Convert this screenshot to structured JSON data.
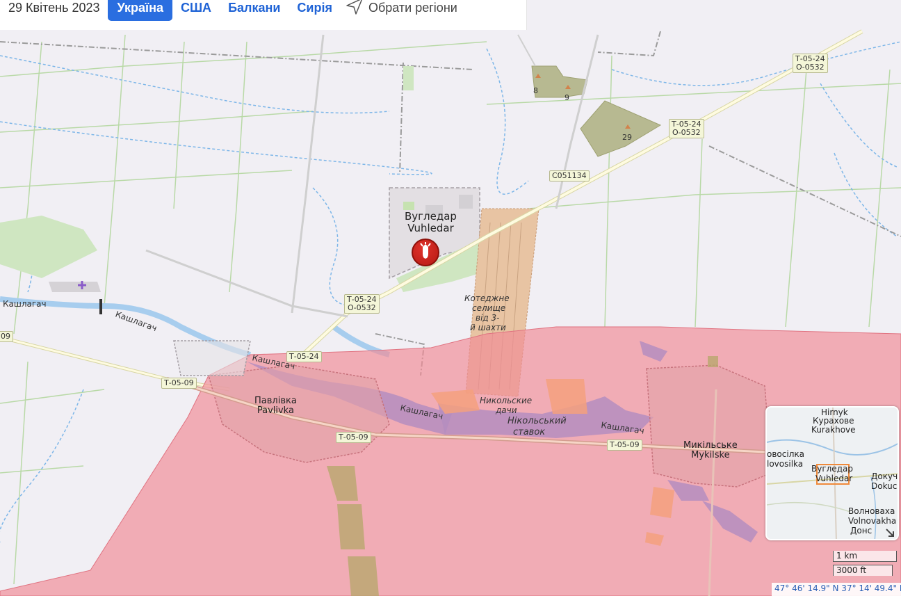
{
  "header": {
    "date": "29 Квітень 2023",
    "tabs": [
      {
        "label": "Україна",
        "active": true
      },
      {
        "label": "США",
        "active": false
      },
      {
        "label": "Балкани",
        "active": false
      },
      {
        "label": "Сирія",
        "active": false
      }
    ],
    "regions_label": "Обрати регіони",
    "regions_icon": "navigation-arrow-icon"
  },
  "map": {
    "occupied_zone_color": "#f08c96",
    "towns": {
      "vuhledar": {
        "uk": "Вугледар",
        "en": "Vuhledar"
      },
      "pavlivka": {
        "uk": "Павлівка",
        "en": "Pavlivka"
      },
      "mykilske": {
        "uk": "Микільське",
        "en": "Mykilske"
      }
    },
    "settlement_note": [
      "Котеджне",
      "селище",
      "від 3-",
      "й шахти"
    ],
    "nykolski_dachi": [
      "Никольские",
      "дачи"
    ],
    "reservoir": [
      "Нікольський",
      "ставок"
    ],
    "rivers": [
      "Кашлагач",
      "Кашлагач",
      "Кашлагач",
      "Кашлагач"
    ],
    "peaks": [
      "8",
      "9",
      "29"
    ],
    "road_labels": {
      "t0524_o0532_a": [
        "Т-05-24",
        "О-0532"
      ],
      "t0524_o0532_b": [
        "Т-05-24",
        "О-0532"
      ],
      "t0524_o0532_c": [
        "Т-05-24",
        "О-0532"
      ],
      "c051134": "С051134",
      "t0524": "Т-05-24",
      "t0509_a": "Т-05-09",
      "t0509_b": "Т-05-09",
      "t0509_c": "Т-05-09",
      "left_cut": "09"
    },
    "marker_icon": "explosion-bomb-icon"
  },
  "inset": {
    "labels": {
      "hirnyk": "Hirnyk",
      "kurakhove_uk": "Курахове",
      "kurakhove_en": "Kurakhove",
      "novosilka_uk": "овосілка",
      "novosilka_en": "lovosilka",
      "vuhledar_uk": "Вугледар",
      "vuhledar_en": "Vuhledar",
      "dokuch_uk": "Докуч",
      "dokuch_en": "Dokuc",
      "volnovakha_uk": "Волноваха",
      "volnovakha_en": "Volnovakha",
      "donets": "Донс"
    },
    "expand_icon": "expand-arrow-icon"
  },
  "scale": {
    "metric": "1 km",
    "imperial": "3000 ft"
  },
  "coordinates": "47° 46' 14.9\" N 37° 14' 49.4\" E"
}
